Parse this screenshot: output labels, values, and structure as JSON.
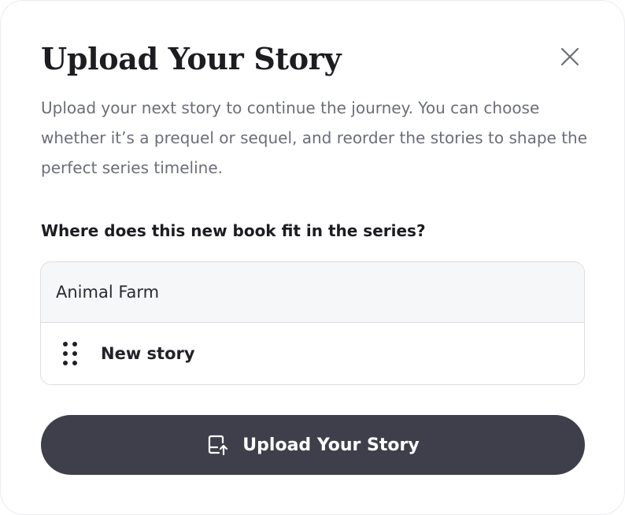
{
  "dialog": {
    "title": "Upload Your Story",
    "description": "Upload your next story to continue the journey. You can choose whether it’s a prequel or sequel, and reorder the stories to shape the perfect series timeline.",
    "close_icon": "close-icon"
  },
  "series": {
    "question": "Where does this new book fit in the series?",
    "items": [
      {
        "label": "Animal Farm",
        "kind": "existing"
      },
      {
        "label": "New story",
        "kind": "new",
        "icon": "drag-handle-icon"
      }
    ]
  },
  "actions": {
    "upload_label": "Upload Your Story",
    "upload_icon": "upload-icon"
  },
  "colors": {
    "button_bg": "#3e3f4b",
    "existing_row_bg": "#f6f7f9",
    "description_text": "#6b6e78",
    "border": "#dcdde1"
  }
}
